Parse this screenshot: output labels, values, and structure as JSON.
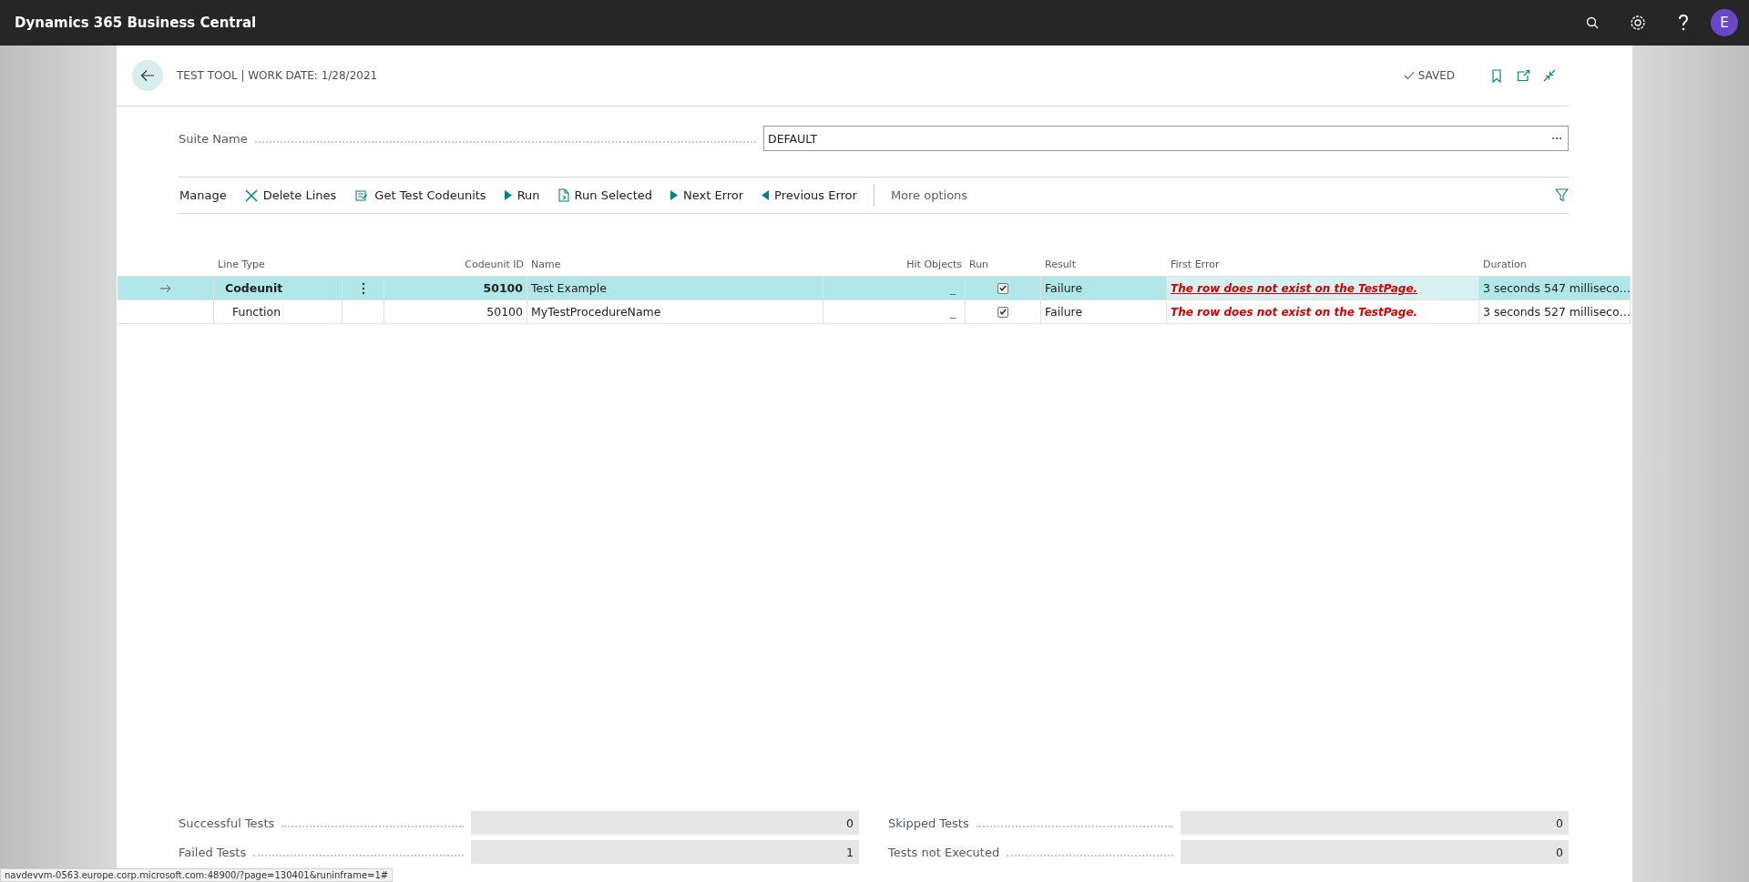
{
  "app_bar": {
    "title": "Dynamics 365 Business Central",
    "avatar": "E"
  },
  "page": {
    "title": "TEST TOOL | WORK DATE: 1/28/2021",
    "save_status": "SAVED"
  },
  "suite": {
    "label": "Suite Name",
    "value": "DEFAULT"
  },
  "actions": [
    {
      "label": "Manage",
      "kind": "text"
    },
    {
      "label": "Delete Lines",
      "kind": "delete"
    },
    {
      "label": "Get Test Codeunits",
      "kind": "get"
    },
    {
      "label": "Run",
      "kind": "run"
    },
    {
      "label": "Run Selected",
      "kind": "runsel"
    },
    {
      "label": "Next Error",
      "kind": "next"
    },
    {
      "label": "Previous Error",
      "kind": "prev"
    },
    {
      "label": "More options",
      "kind": "more"
    }
  ],
  "table": {
    "columns": [
      {
        "label": "Line Type"
      },
      {
        "label": "Codeunit ID"
      },
      {
        "label": "Name"
      },
      {
        "label": "Hit Objects"
      },
      {
        "label": "Run"
      },
      {
        "label": "Result"
      },
      {
        "label": "First Error"
      },
      {
        "label": "Duration"
      }
    ],
    "rows": [
      {
        "selected": true,
        "kind": "codeunit",
        "line_type": "Codeunit",
        "codeunit_id": "50100",
        "name": "Test Example",
        "hit_objects": "_",
        "run": true,
        "result": "Failure",
        "first_error": "The row does not exist on the TestPage.",
        "error_hovered": true,
        "duration": "3 seconds 547 milliseco…"
      },
      {
        "selected": false,
        "kind": "function",
        "line_type": "Function",
        "codeunit_id": "50100",
        "name": "MyTestProcedureName",
        "hit_objects": "_",
        "run": true,
        "result": "Failure",
        "first_error": "The row does not exist on the TestPage.",
        "error_hovered": false,
        "duration": "3 seconds 527 milliseco…"
      }
    ]
  },
  "summary": [
    {
      "label": "Successful Tests",
      "value": "0"
    },
    {
      "label": "Skipped Tests",
      "value": "0"
    },
    {
      "label": "Failed Tests",
      "value": "1"
    },
    {
      "label": "Tests not Executed",
      "value": "0"
    }
  ],
  "status_url": "navdevvm-0563.europe.corp.microsoft.com:48900/?page=130401&runinframe=1#"
}
